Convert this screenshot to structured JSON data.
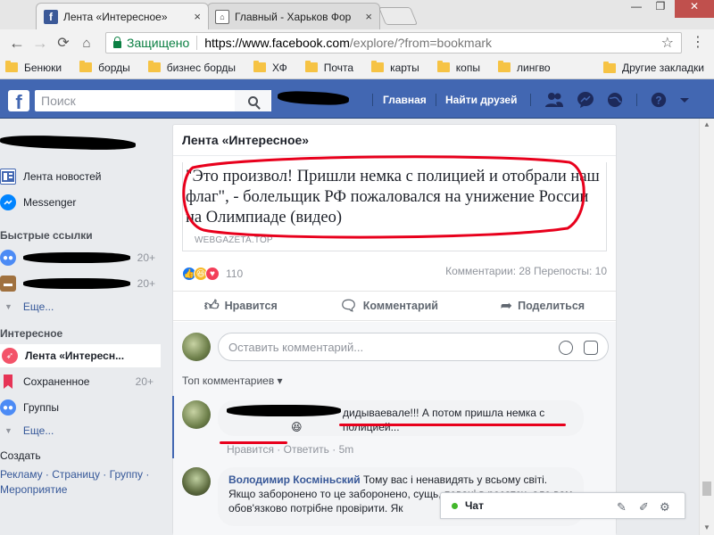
{
  "browser": {
    "tabs": [
      {
        "title": "Лента «Интересное»",
        "active": true,
        "icon": "facebook-icon"
      },
      {
        "title": "Главный - Харьков Фор",
        "active": false,
        "icon": "forum-icon"
      }
    ],
    "address": {
      "secure_label": "Защищено",
      "url_host": "https://www.facebook.com",
      "url_path": "/explore/?from=bookmark"
    },
    "bookmarks": [
      "Бенюки",
      "борды",
      "бизнес борды",
      "ХФ",
      "Почта",
      "карты",
      "копы",
      "лингво"
    ],
    "other_bookmarks": "Другие закладки"
  },
  "facebook": {
    "search_placeholder": "Поиск",
    "nav_home": "Главная",
    "nav_find_friends": "Найти друзей",
    "brand_color": "#4267b2"
  },
  "sidebar": {
    "items": [
      {
        "label": "Лента новостей",
        "icon": "news-feed-icon"
      },
      {
        "label": "Messenger",
        "icon": "messenger-icon"
      }
    ],
    "quick_links_title": "Быстрые ссылки",
    "quick_links": [
      {
        "count": "20+",
        "icon": "group-icon"
      },
      {
        "count": "20+",
        "icon": "briefcase-icon"
      }
    ],
    "more_label": "Еще...",
    "explore_title": "Интересное",
    "explore_items": [
      {
        "label": "Лента «Интересн...",
        "icon": "rocket-icon",
        "count": ""
      },
      {
        "label": "Сохраненное",
        "icon": "bookmark-icon",
        "count": "20+"
      },
      {
        "label": "Группы",
        "icon": "groups-icon",
        "count": ""
      }
    ],
    "more_label_2": "Еще...",
    "create_title": "Создать",
    "create_links": "Рекламу · Страницу · Группу · Мероприятие"
  },
  "feed": {
    "title": "Лента «Интересное»",
    "headline": "\"Это произвол! Пришли немка с полицией и отобрали наш флаг\", - болельщик РФ пожаловался на унижение России на Олимпиаде (видео)",
    "source": "WEBGAZETA.TOP",
    "reactions_count": "110",
    "stats": "Комментарии: 28   Перепосты: 10",
    "actions": {
      "like": "Нравится",
      "comment": "Комментарий",
      "share": "Поделиться"
    },
    "comment_placeholder": "Оставить комментарий...",
    "top_comments": "Топ комментариев",
    "comments": [
      {
        "text": "дидываевале!!! А потом пришла немка с полицией...",
        "emoji": "😆",
        "meta": "Нравится · Ответить · 5m"
      },
      {
        "author": "Володимир Косміньский",
        "text": "Тому вас і ненавидять у всьому світі. Якщо заборонено то це заборонено, сущь, певані в росатех, але вам обов'язково потрібне провірити. Як"
      }
    ]
  },
  "chat": {
    "label": "Чат"
  }
}
